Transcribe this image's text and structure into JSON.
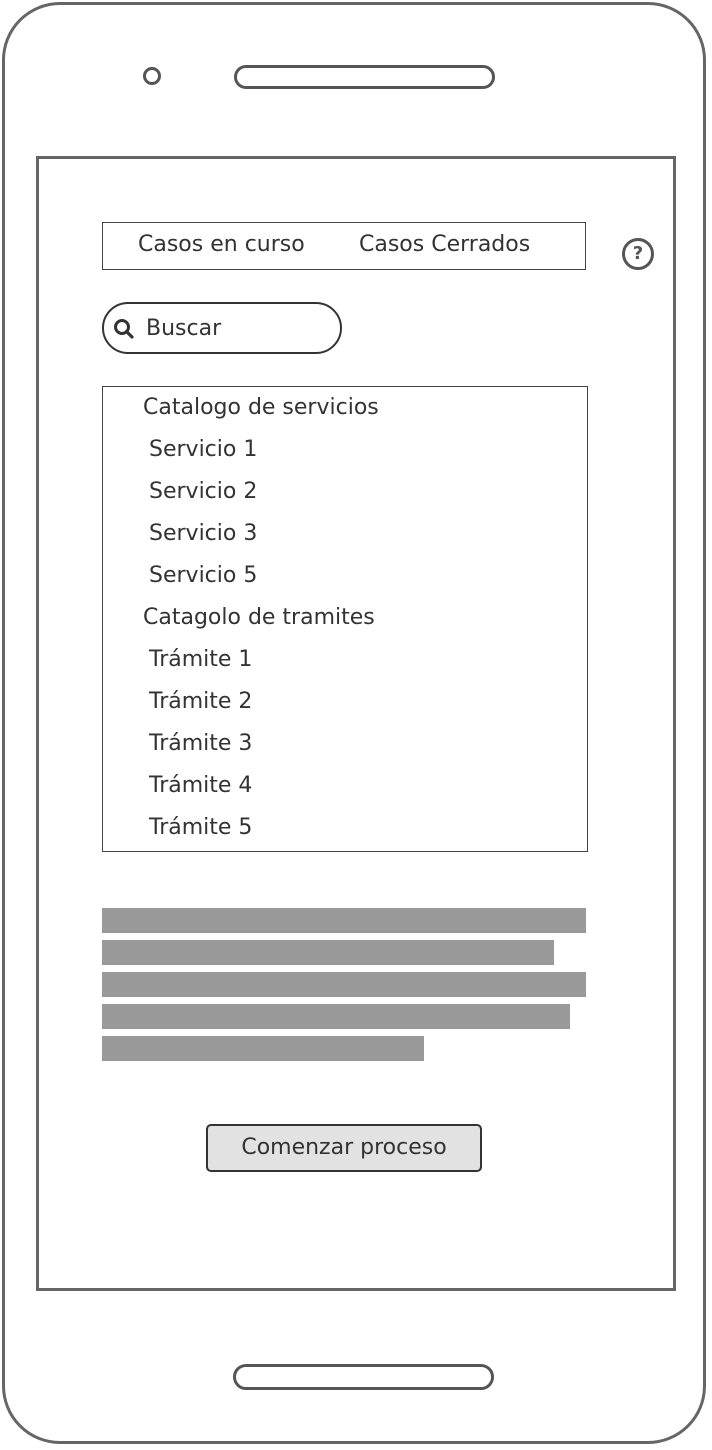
{
  "tabs": {
    "open_cases": "Casos en curso",
    "closed_cases": "Casos Cerrados"
  },
  "help": {
    "glyph": "?",
    "icon": "question-circle-icon"
  },
  "search": {
    "placeholder": "Buscar",
    "value": "",
    "icon": "search-icon"
  },
  "catalog": {
    "services_header": "Catalogo de servicios",
    "services": [
      "Servicio 1",
      "Servicio 2",
      "Servicio 3",
      "Servicio 5"
    ],
    "procedures_header": "Catagolo de tramites",
    "procedures": [
      "Trámite 1",
      "Trámite 2",
      "Trámite 3",
      "Trámite 4",
      "Trámite 5"
    ]
  },
  "placeholder_text": {
    "line_count": 5
  },
  "actions": {
    "start_label": "Comenzar proceso"
  },
  "colors": {
    "frame": "#666666",
    "text": "#333333",
    "placeholder_bar": "#999999",
    "button_fill": "#e2e2e2"
  }
}
